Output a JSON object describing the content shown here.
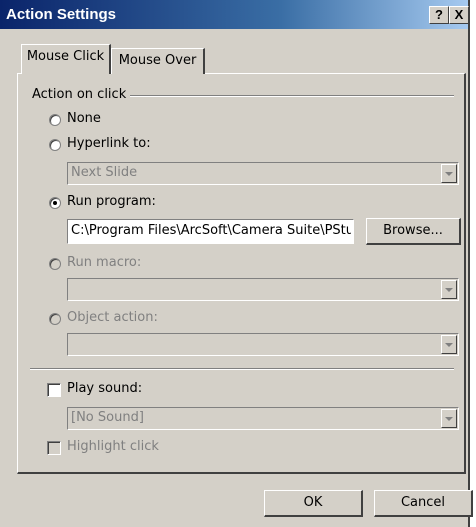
{
  "window": {
    "title": "Action Settings",
    "help_label": "?",
    "close_label": "X"
  },
  "tabs": [
    {
      "label": "Mouse Click",
      "active": true
    },
    {
      "label": "Mouse Over",
      "active": false
    }
  ],
  "group": {
    "label": "Action on click"
  },
  "options": {
    "none": {
      "label": "None",
      "checked": false,
      "enabled": true
    },
    "hyperlink": {
      "label": "Hyperlink to:",
      "checked": false,
      "enabled": true,
      "value": "Next Slide"
    },
    "run_program": {
      "label": "Run program:",
      "checked": true,
      "enabled": true,
      "value": "C:\\Program Files\\ArcSoft\\Camera Suite\\PStu",
      "browse_label": "Browse..."
    },
    "run_macro": {
      "label": "Run macro:",
      "checked": false,
      "enabled": false,
      "value": ""
    },
    "object_action": {
      "label": "Object action:",
      "checked": false,
      "enabled": false,
      "value": ""
    }
  },
  "sound": {
    "label": "Play sound:",
    "checked": false,
    "value": "[No Sound]"
  },
  "highlight": {
    "label": "Highlight click",
    "checked": false,
    "enabled": false
  },
  "buttons": {
    "ok": "OK",
    "cancel": "Cancel"
  }
}
